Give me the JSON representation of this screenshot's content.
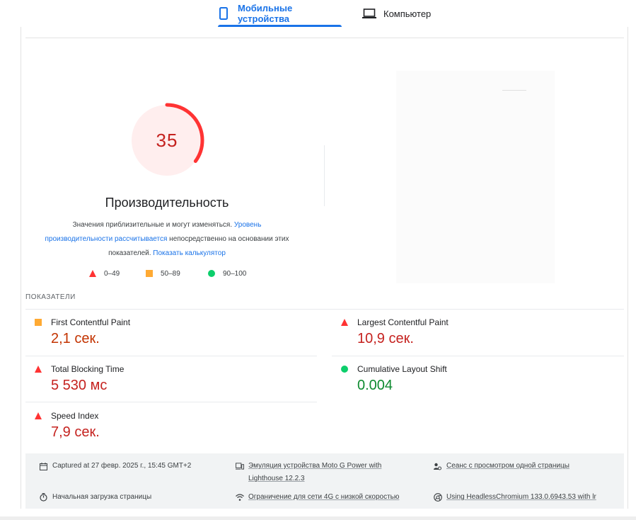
{
  "tabs": {
    "mobile": "Мобильные устройства",
    "desktop": "Компьютер"
  },
  "performance": {
    "score": "35",
    "score_fraction": 0.35,
    "title": "Производительность",
    "desc_part1": "Значения приблизительные и могут изменяться.",
    "desc_link1": "Уровень производительности рассчитывается",
    "desc_part2": "непосредственно на основании этих показателей.",
    "desc_link2": "Показать калькулятор"
  },
  "legend": {
    "poor": "0–49",
    "average": "50–89",
    "good": "90–100"
  },
  "metrics": {
    "section_title": "ПОКАЗАТЕЛИ",
    "fcp": {
      "label": "First Contentful Paint",
      "value": "2,1 сек."
    },
    "lcp": {
      "label": "Largest Contentful Paint",
      "value": "10,9 сек."
    },
    "tbt": {
      "label": "Total Blocking Time",
      "value": "5 530 мс"
    },
    "cls": {
      "label": "Cumulative Layout Shift",
      "value": "0.004"
    },
    "si": {
      "label": "Speed Index",
      "value": "7,9 сек."
    }
  },
  "footer": {
    "captured": "Captured at 27 февр. 2025 г., 15:45 GMT+2",
    "emulation_line1": "Эмуляция устройства Moto G Power with",
    "emulation_line2": "Lighthouse 12.2.3",
    "session": "Сеанс с просмотром одной страницы",
    "initial_load": "Начальная загрузка страницы",
    "throttling": "Ограничение для сети 4G с низкой скоростью",
    "browser": "Using HeadlessChromium 133.0.6943.53 with lr"
  },
  "colors": {
    "accent": "#1a73e8",
    "poor": "#ff3333",
    "average": "#ffaa33",
    "good": "#0cce6b",
    "poor_text": "#c5221f",
    "good_text": "#0d8a2f"
  }
}
